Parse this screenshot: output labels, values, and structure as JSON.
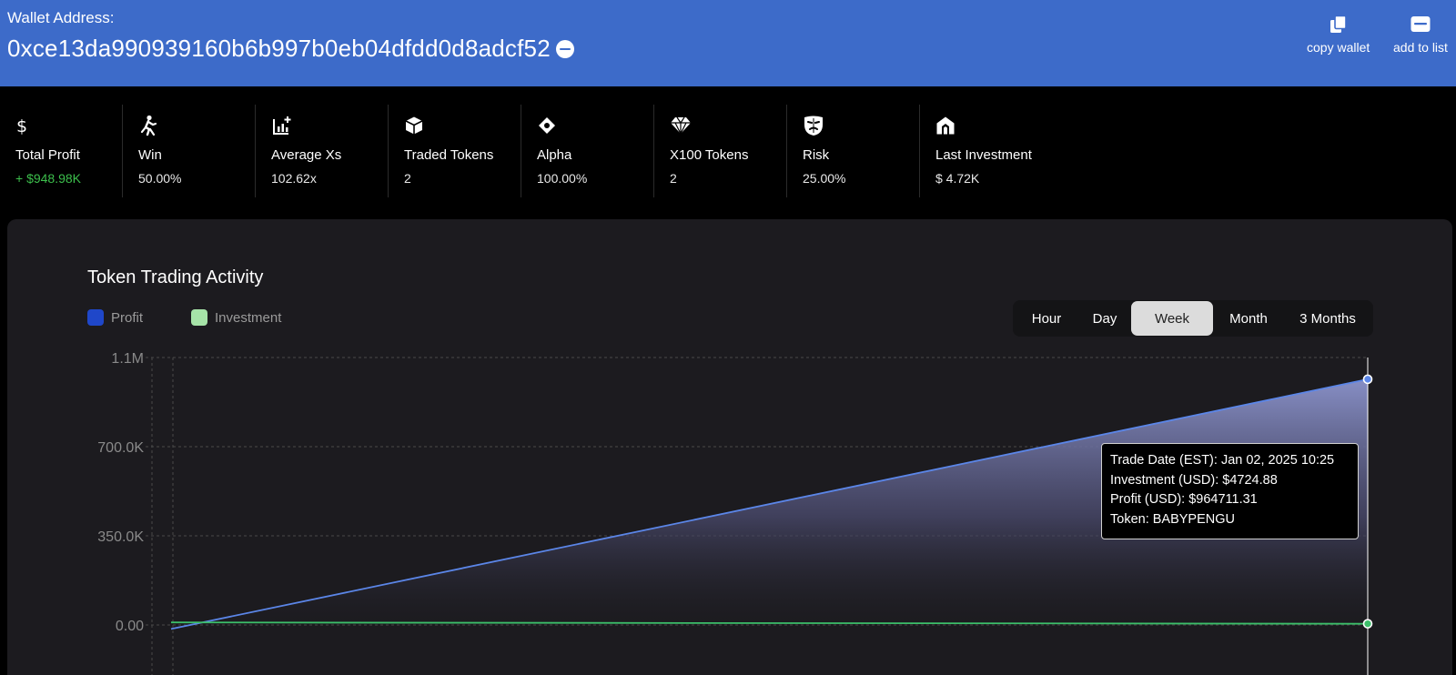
{
  "header": {
    "wallet_label": "Wallet Address:",
    "wallet_address": "0xce13da990939160b6b997b0eb04dfdd0d8adcf52",
    "actions": [
      {
        "label": "copy wallet",
        "icon": "copy-icon"
      },
      {
        "label": "add to list",
        "icon": "wallet-icon"
      }
    ]
  },
  "stats": [
    {
      "label": "Total Profit",
      "value": "+ $948.98K",
      "icon": "dollar-icon",
      "value_color": "#3cbf4c"
    },
    {
      "label": "Win",
      "value": "50.00%",
      "icon": "runner-icon"
    },
    {
      "label": "Average Xs",
      "value": "102.62x",
      "icon": "chart-plus-icon"
    },
    {
      "label": "Traded Tokens",
      "value": "2",
      "icon": "cube-icon"
    },
    {
      "label": "Alpha",
      "value": "100.00%",
      "icon": "eye-diamond-icon"
    },
    {
      "label": "X100 Tokens",
      "value": "2",
      "icon": "gem-icon"
    },
    {
      "label": "Risk",
      "value": "25.00%",
      "icon": "masks-icon"
    },
    {
      "label": "Last Investment",
      "value": "$ 4.72K",
      "icon": "home-shield-icon"
    }
  ],
  "chart": {
    "title": "Token Trading Activity",
    "legend": [
      {
        "name": "Profit",
        "color": "#1f47c9"
      },
      {
        "name": "Investment",
        "color": "#a6e3a8"
      }
    ],
    "periods": [
      "Hour",
      "Day",
      "Week",
      "Month",
      "3 Months"
    ],
    "active_period": "Week",
    "tooltip": [
      "Trade Date (EST): Jan 02, 2025 10:25",
      "Investment (USD): $4724.88",
      "Profit (USD): $964711.31",
      "Token: BABYPENGU"
    ]
  },
  "chart_data": {
    "type": "area",
    "y_tick_labels": [
      "1.1M",
      "700.0K",
      "350.0K",
      "0.00"
    ],
    "y_ticks": [
      1050000,
      700000,
      350000,
      0
    ],
    "ylim": [
      0,
      1050000
    ],
    "grid": true,
    "legend_position": "top-left",
    "series": [
      {
        "name": "Profit",
        "color": "#5b86e8",
        "x": [
          0,
          1
        ],
        "values": [
          -15759.9,
          964711.31
        ]
      },
      {
        "name": "Investment",
        "color": "#3cbf6a",
        "x": [
          0,
          1
        ],
        "values": [
          10000,
          4724.88
        ]
      }
    ]
  }
}
